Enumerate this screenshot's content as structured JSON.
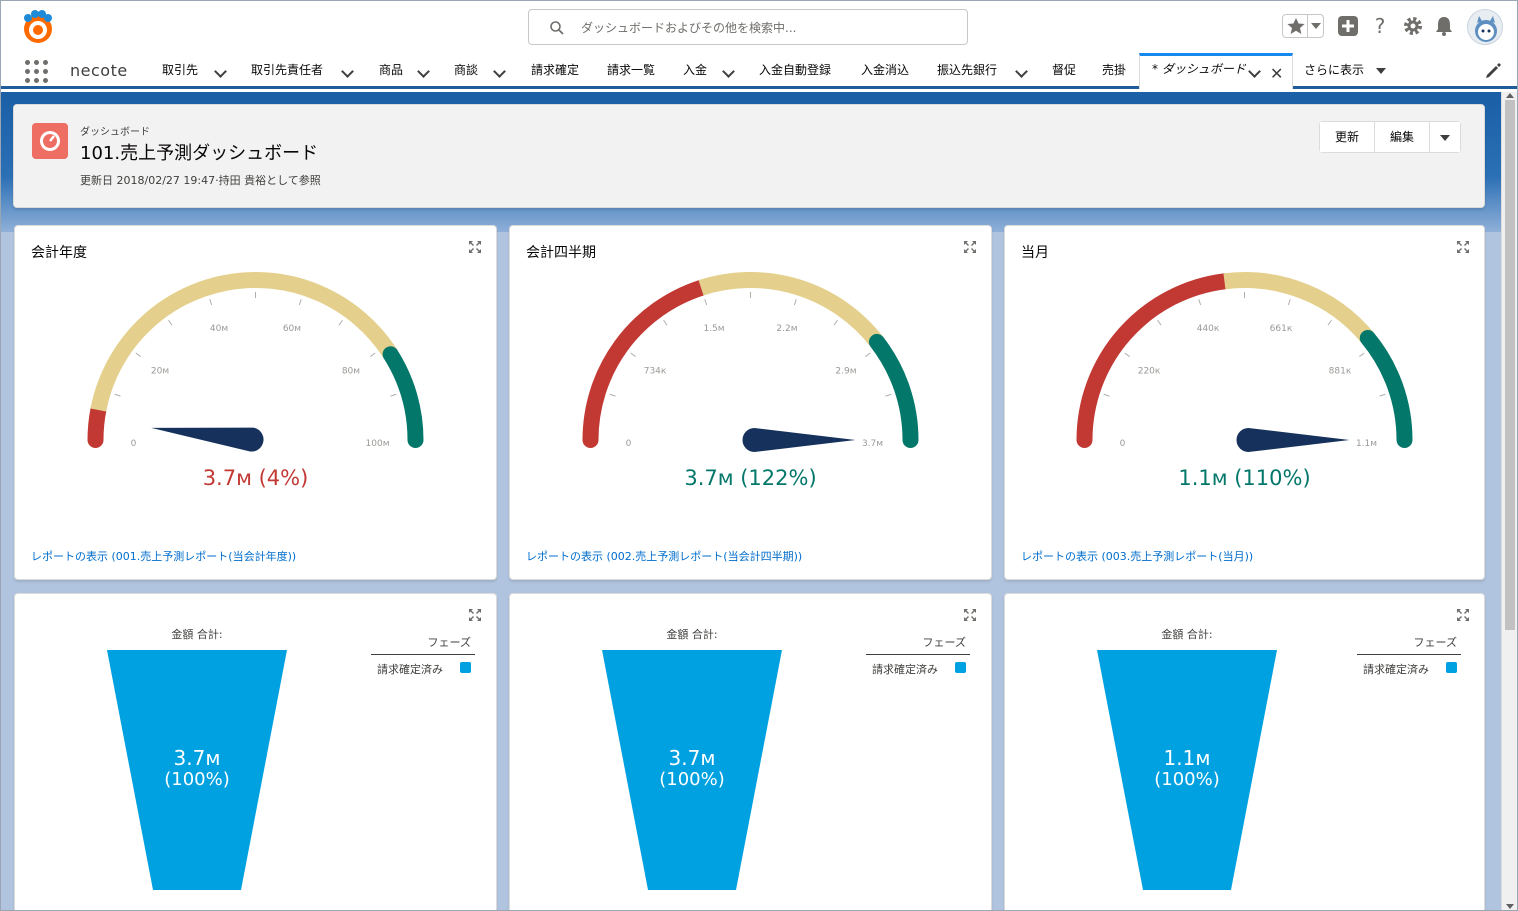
{
  "header": {
    "search_placeholder": "ダッシュボードおよびその他を検索中..."
  },
  "nav": {
    "app_name": "necote",
    "items": [
      {
        "label": "取引先",
        "dropdown": true
      },
      {
        "label": "取引先責任者",
        "dropdown": true
      },
      {
        "label": "商品",
        "dropdown": true
      },
      {
        "label": "商談",
        "dropdown": true
      },
      {
        "label": "請求確定",
        "dropdown": false
      },
      {
        "label": "請求一覧",
        "dropdown": false
      },
      {
        "label": "入金",
        "dropdown": true
      },
      {
        "label": "入金自動登録",
        "dropdown": false
      },
      {
        "label": "入金消込",
        "dropdown": false
      },
      {
        "label": "振込先銀行",
        "dropdown": true
      },
      {
        "label": "督促",
        "dropdown": false
      },
      {
        "label": "売掛",
        "dropdown": false
      }
    ],
    "active_tab": "* ダッシュボード",
    "more_label": "さらに表示"
  },
  "dashboard": {
    "type_label": "ダッシュボード",
    "title": "101.売上予測ダッシュボード",
    "meta": "更新日 2018/02/27 19:47·持田 貴裕として参照",
    "buttons": {
      "refresh": "更新",
      "edit": "編集"
    }
  },
  "colors": {
    "red": "#c23934",
    "yellow": "#e4d08c",
    "teal": "#04776b",
    "needle": "#16325c",
    "funnel": "#00a1e0"
  },
  "gauges": [
    {
      "title": "会計年度",
      "ticks": [
        "0",
        "20м",
        "40м",
        "60м",
        "80м",
        "100м"
      ],
      "value_fraction": 0.037,
      "bands": [
        0.06,
        0.82
      ],
      "readout": "3.7м (4%)",
      "readout_color": "#c23934",
      "link": "レポートの表示 (001.売上予測レポート(当会計年度))"
    },
    {
      "title": "会計四半期",
      "ticks": [
        "0",
        "734к",
        "1.5м",
        "2.2м",
        "2.9м",
        "3.7м"
      ],
      "value_fraction": 1.0,
      "bands": [
        0.4,
        0.79
      ],
      "readout": "3.7м (122%)",
      "readout_color": "#04776b",
      "link": "レポートの表示 (002.売上予測レポート(当会計四半期))"
    },
    {
      "title": "当月",
      "ticks": [
        "0",
        "220к",
        "440к",
        "661к",
        "881к",
        "1.1м"
      ],
      "value_fraction": 1.0,
      "bands": [
        0.46,
        0.78
      ],
      "readout": "1.1м (110%)",
      "readout_color": "#04776b",
      "link": "レポートの表示 (003.売上予測レポート(当月))"
    }
  ],
  "funnels": [
    {
      "label": "金額 合計:",
      "value": "3.7м",
      "pct": "(100%)",
      "legend_title": "フェーズ",
      "legend_item": "請求確定済み"
    },
    {
      "label": "金額 合計:",
      "value": "3.7м",
      "pct": "(100%)",
      "legend_title": "フェーズ",
      "legend_item": "請求確定済み"
    },
    {
      "label": "金額 合計:",
      "value": "1.1м",
      "pct": "(100%)",
      "legend_title": "フェーズ",
      "legend_item": "請求確定済み"
    }
  ]
}
